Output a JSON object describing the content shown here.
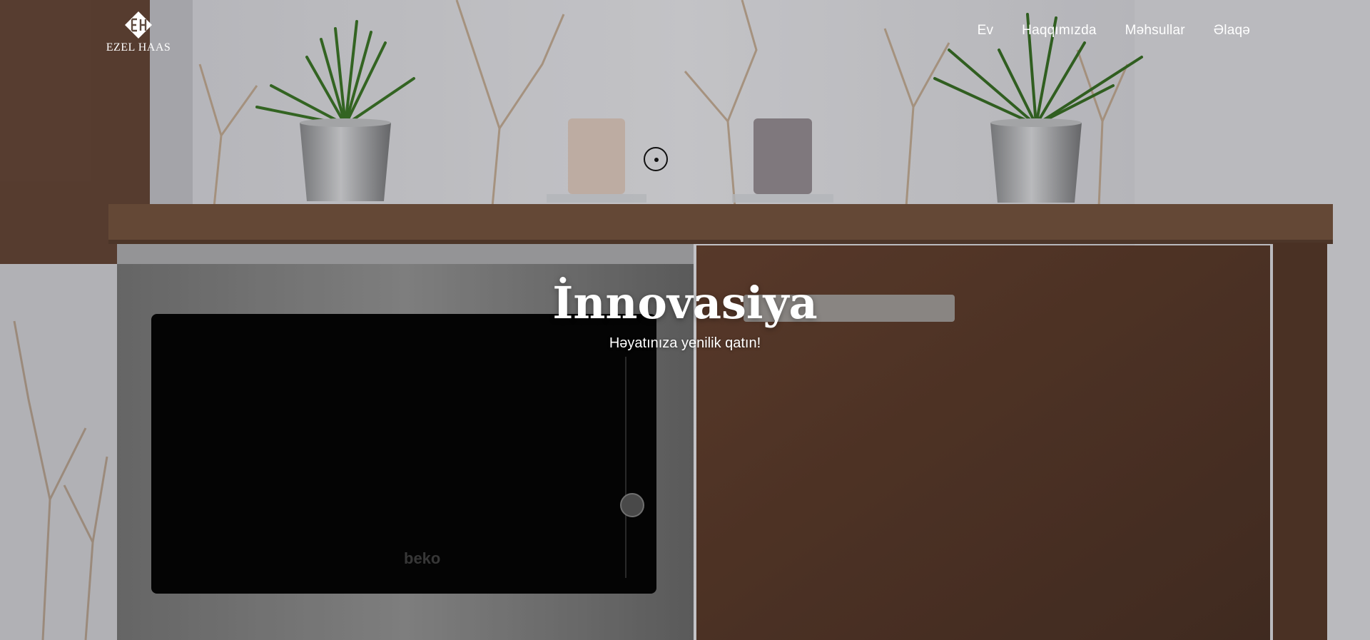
{
  "brand": {
    "name": "EZEL HAAS",
    "monogram": "EH"
  },
  "nav": {
    "items": [
      {
        "label": "Ev"
      },
      {
        "label": "Haqqımızda"
      },
      {
        "label": "Məhsullar"
      },
      {
        "label": "Əlaqə"
      }
    ]
  },
  "hero": {
    "title": "İnnovasiya",
    "subtitle": "Həyatınıza yenilik qatın!",
    "image_subject": "kitchen-counter-with-built-in-microwave-plants-and-candles"
  },
  "colors": {
    "text": "#ffffff",
    "cabinet": "#6e4a35",
    "countertop": "#7a5640",
    "wall": "#e9e9ee",
    "microwave_frame": "#8a8a8a",
    "plant_green": "#3f7a2a"
  },
  "icons": {
    "cursor": "target-cursor-icon"
  }
}
